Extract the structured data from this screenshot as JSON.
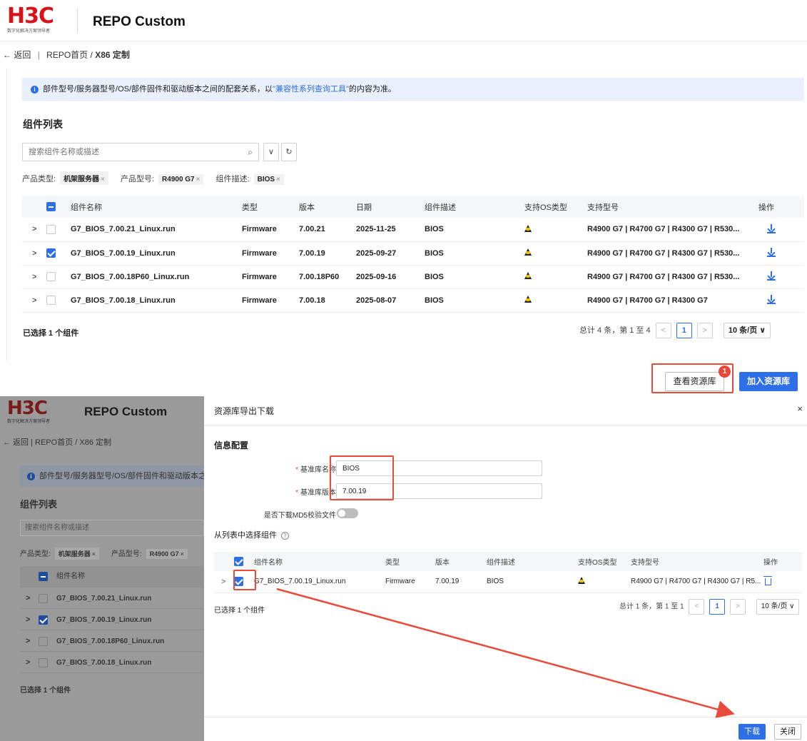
{
  "top": {
    "logo": {
      "brand": "H3C",
      "tagline": "数字化解决方案领导者"
    },
    "app_title": "REPO Custom",
    "breadcrumb": {
      "back": "← 返回",
      "sep": "|",
      "home": "REPO首页",
      "slash": "/",
      "current": "X86 定制"
    },
    "banner": {
      "text_before": "部件型号/服务器型号/OS/部件固件和驱动版本之间的配套关系，以",
      "link": "\"兼容性系列查询工具\"",
      "text_after": "的内容为准。"
    },
    "section_title": "组件列表",
    "search": {
      "placeholder": "搜索组件名称或描述"
    },
    "filters": [
      {
        "label": "产品类型:",
        "value": "机架服务器"
      },
      {
        "label": "产品型号:",
        "value": "R4900 G7"
      },
      {
        "label": "组件描述:",
        "value": "BIOS"
      }
    ],
    "table": {
      "headers": [
        "组件名称",
        "类型",
        "版本",
        "日期",
        "组件描述",
        "支持OS类型",
        "支持型号",
        "操作"
      ],
      "rows": [
        {
          "name": "G7_BIOS_7.00.21_Linux.run",
          "type": "Firmware",
          "version": "7.00.21",
          "date": "2025-11-25",
          "desc": "BIOS",
          "models": "R4900 G7 | R4700 G7 | R4300 G7 | R530...",
          "checked": false
        },
        {
          "name": "G7_BIOS_7.00.19_Linux.run",
          "type": "Firmware",
          "version": "7.00.19",
          "date": "2025-09-27",
          "desc": "BIOS",
          "models": "R4900 G7 | R4700 G7 | R4300 G7 | R530...",
          "checked": true
        },
        {
          "name": "G7_BIOS_7.00.18P60_Linux.run",
          "type": "Firmware",
          "version": "7.00.18P60",
          "date": "2025-09-16",
          "desc": "BIOS",
          "models": "R4900 G7 | R4700 G7 | R4300 G7 | R530...",
          "checked": false
        },
        {
          "name": "G7_BIOS_7.00.18_Linux.run",
          "type": "Firmware",
          "version": "7.00.18",
          "date": "2025-08-07",
          "desc": "BIOS",
          "models": "R4900 G7 | R4700 G7 | R4300 G7",
          "checked": false
        }
      ]
    },
    "selected_text": "已选择 1 个组件",
    "pager": {
      "summary": "总计 4 条，第 1 至 4",
      "page": "1",
      "size": "10 条/页 ∨"
    },
    "buttons": {
      "view_repo": "查看资源库",
      "add_repo": "加入资源库"
    },
    "badge": "1"
  },
  "bottom": {
    "overlay": {
      "app_title": "REPO Custom",
      "breadcrumb": "← 返回 | REPO首页 / X86 定制",
      "banner": "部件型号/服务器型号/OS/部件固件和驱动版本之间的",
      "section_title": "组件列表",
      "search_placeholder": "搜索组件名称或描述",
      "filter1_label": "产品类型:",
      "filter1_value": "机架服务器",
      "filter2_label": "产品型号:",
      "filter2_value": "R4900 G7",
      "header": "组件名称",
      "rows": [
        "G7_BIOS_7.00.21_Linux.run",
        "G7_BIOS_7.00.19_Linux.run",
        "G7_BIOS_7.00.18P60_Linux.run",
        "G7_BIOS_7.00.18_Linux.run"
      ],
      "selected_text": "已选择 1 个组件"
    },
    "drawer": {
      "title": "资源库导出下载",
      "close": "×",
      "section_info": "信息配置",
      "fields": {
        "name_label": "基准库名称",
        "name_value": "BIOS",
        "version_label": "基准库版本",
        "version_value": "7.00.19",
        "md5_label": "是否下载MD5校验文件"
      },
      "section_select": "从列表中选择组件",
      "table": {
        "headers": [
          "组件名称",
          "类型",
          "版本",
          "组件描述",
          "支持OS类型",
          "支持型号",
          "操作"
        ],
        "row": {
          "name": "G7_BIOS_7.00.19_Linux.run",
          "type": "Firmware",
          "version": "7.00.19",
          "desc": "BIOS",
          "models": "R4900 G7 | R4700 G7 | R4300 G7 | R5..."
        }
      },
      "selected_text": "已选择 1 个组件",
      "pager": {
        "summary": "总计 1 条，第 1 至 1",
        "page": "1",
        "size": "10 条/页 ∨"
      },
      "buttons": {
        "download": "下载",
        "close": "关闭"
      }
    }
  },
  "colors": {
    "accent": "#2c6fe6",
    "brand_red": "#d7131a",
    "highlight": "#e84a3c"
  }
}
